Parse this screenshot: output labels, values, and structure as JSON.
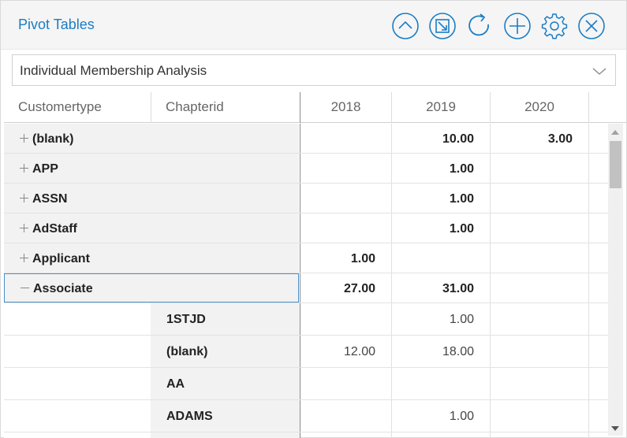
{
  "header": {
    "title": "Pivot Tables",
    "accent_color": "#1a7dc4",
    "icons": [
      "collapse-up-icon",
      "minimize-icon",
      "refresh-icon",
      "add-icon",
      "settings-gear-icon",
      "close-icon"
    ]
  },
  "selector": {
    "value": "Individual Membership Analysis",
    "icon": "chevron-down-icon"
  },
  "columns": {
    "row_headers": [
      "Customertype",
      "Chapterid"
    ],
    "years": [
      "2018",
      "2019",
      "2020"
    ]
  },
  "rows": [
    {
      "label": "(blank)",
      "expand": "plus",
      "v2018": "",
      "v2019": "10.00",
      "v2020": "3.00"
    },
    {
      "label": "APP",
      "expand": "plus",
      "v2018": "",
      "v2019": "1.00",
      "v2020": ""
    },
    {
      "label": "ASSN",
      "expand": "plus",
      "v2018": "",
      "v2019": "1.00",
      "v2020": ""
    },
    {
      "label": "AdStaff",
      "expand": "plus",
      "v2018": "",
      "v2019": "1.00",
      "v2020": ""
    },
    {
      "label": "Applicant",
      "expand": "plus",
      "v2018": "1.00",
      "v2019": "",
      "v2020": ""
    },
    {
      "label": "Associate",
      "expand": "minus",
      "v2018": "27.00",
      "v2019": "31.00",
      "v2020": ""
    }
  ],
  "child_rows": [
    {
      "label": "1STJD",
      "v2018": "",
      "v2019": "1.00",
      "v2020": ""
    },
    {
      "label": "(blank)",
      "v2018": "12.00",
      "v2019": "18.00",
      "v2020": ""
    },
    {
      "label": "AA",
      "v2018": "",
      "v2019": "",
      "v2020": ""
    },
    {
      "label": "ADAMS",
      "v2018": "",
      "v2019": "1.00",
      "v2020": ""
    }
  ]
}
